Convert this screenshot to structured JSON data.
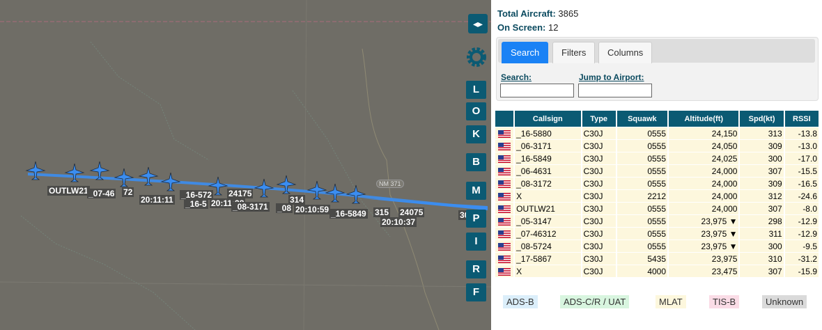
{
  "map": {
    "road_sign": "NM 371",
    "toggle_label": "◂▸",
    "layer_buttons": [
      "L",
      "O",
      "K",
      "B",
      "M",
      "P",
      "I",
      "R",
      "F"
    ],
    "aircraft_labels": [
      "OUTLW21",
      "_07-46",
      "72",
      "20:11:11",
      "_16-572",
      "_16-5",
      "20:11:38",
      "24175",
      "_08-3171",
      "_08",
      "314",
      "20:10:59",
      "_16-5849",
      "315",
      "24075",
      "20:10:37",
      "30"
    ]
  },
  "panel": {
    "total_label": "Total Aircraft:",
    "total_value": "3865",
    "onscreen_label": "On Screen:",
    "onscreen_value": "12",
    "tabs": [
      "Search",
      "Filters",
      "Columns"
    ],
    "search_label": "Search:",
    "airport_label": "Jump to Airport:",
    "search_value": "",
    "airport_value": ""
  },
  "table": {
    "columns": [
      "",
      "Callsign",
      "Type",
      "Squawk",
      "Altitude(ft)",
      "Spd(kt)",
      "RSSI"
    ],
    "rows": [
      {
        "callsign": "_16-5880",
        "type": "C30J",
        "squawk": "0555",
        "altitude": "24,150",
        "speed": "313",
        "rssi": "-13.8"
      },
      {
        "callsign": "_06-3171",
        "type": "C30J",
        "squawk": "0555",
        "altitude": "24,050",
        "speed": "309",
        "rssi": "-13.0"
      },
      {
        "callsign": "_16-5849",
        "type": "C30J",
        "squawk": "0555",
        "altitude": "24,025",
        "speed": "300",
        "rssi": "-17.0"
      },
      {
        "callsign": "_06-4631",
        "type": "C30J",
        "squawk": "0555",
        "altitude": "24,000",
        "speed": "307",
        "rssi": "-15.5"
      },
      {
        "callsign": "_08-3172",
        "type": "C30J",
        "squawk": "0555",
        "altitude": "24,000",
        "speed": "309",
        "rssi": "-16.5"
      },
      {
        "callsign": "X",
        "type": "C30J",
        "squawk": "2212",
        "altitude": "24,000",
        "speed": "312",
        "rssi": "-24.6"
      },
      {
        "callsign": "OUTLW21",
        "type": "C30J",
        "squawk": "0555",
        "altitude": "24,000",
        "speed": "307",
        "rssi": "-8.0"
      },
      {
        "callsign": "_05-3147",
        "type": "C30J",
        "squawk": "0555",
        "altitude": "23,975 ▼",
        "speed": "298",
        "rssi": "-12.9"
      },
      {
        "callsign": "_07-46312",
        "type": "C30J",
        "squawk": "0555",
        "altitude": "23,975 ▼",
        "speed": "311",
        "rssi": "-12.9"
      },
      {
        "callsign": "_08-5724",
        "type": "C30J",
        "squawk": "0555",
        "altitude": "23,975 ▼",
        "speed": "300",
        "rssi": "-9.5"
      },
      {
        "callsign": "_17-5867",
        "type": "C30J",
        "squawk": "5435",
        "altitude": "23,975",
        "speed": "310",
        "rssi": "-31.2"
      },
      {
        "callsign": "X",
        "type": "C30J",
        "squawk": "4000",
        "altitude": "23,475",
        "speed": "307",
        "rssi": "-15.9"
      }
    ]
  },
  "legend": [
    {
      "label": "ADS-B",
      "color": "#dbeefa"
    },
    {
      "label": "ADS-C/R / UAT",
      "color": "#d8f5df"
    },
    {
      "label": "MLAT",
      "color": "#fdf7dd"
    },
    {
      "label": "TIS-B",
      "color": "#fadce6"
    },
    {
      "label": "Unknown",
      "color": "#dadada"
    }
  ],
  "colors": {
    "accent": "#0b5a73",
    "tab_active": "#1a82f5",
    "aircraft": "#3b8df0",
    "row_bg": "#fdf7dd"
  }
}
